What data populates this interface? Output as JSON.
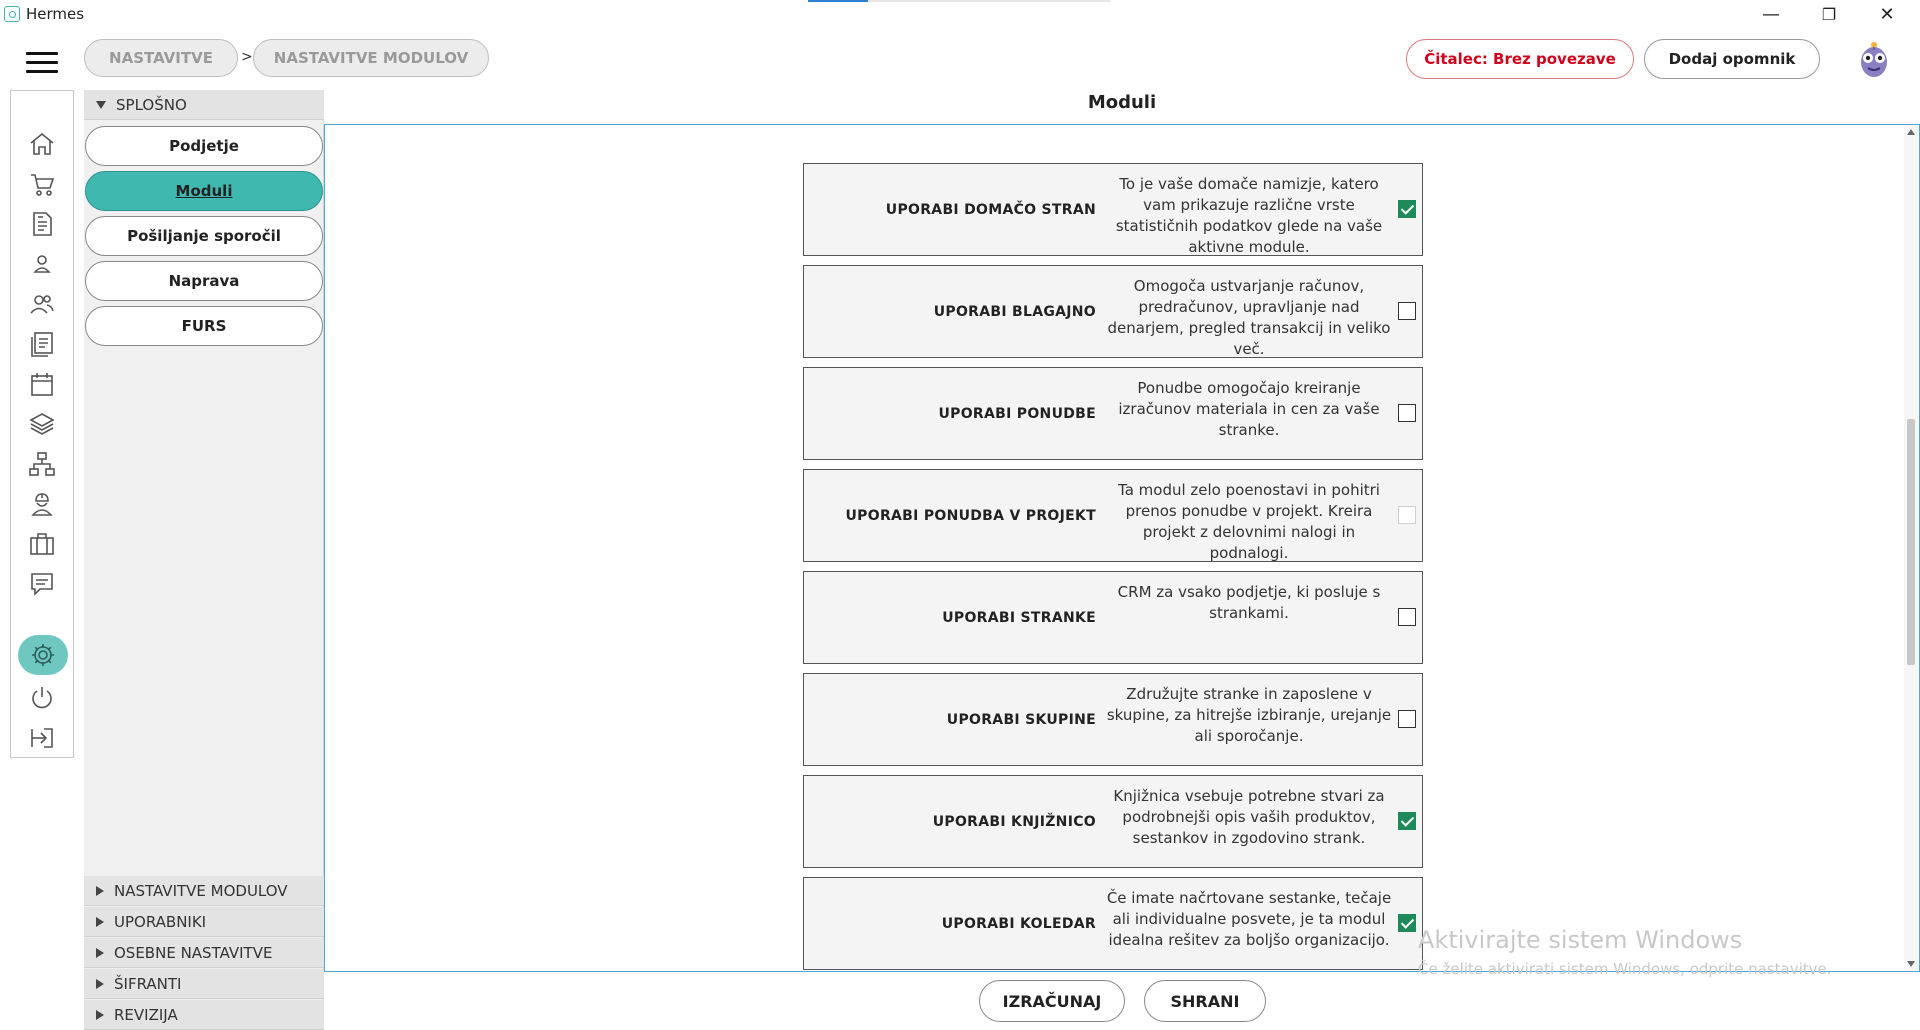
{
  "window": {
    "title": "Hermes",
    "minimize": "—",
    "restore": "❐",
    "close": "✕"
  },
  "breadcrumb": {
    "items": [
      "NASTAVITVE",
      "NASTAVITVE MODULOV"
    ],
    "separator": ">"
  },
  "header": {
    "reader_status": "Čitalec: Brez povezave",
    "add_reminder": "Dodaj opomnik"
  },
  "settings_nav": {
    "general_section": "SPLOŠNO",
    "general_items": [
      {
        "label": "Podjetje",
        "active": false
      },
      {
        "label": "Moduli",
        "active": true
      },
      {
        "label": "Pošiljanje sporočil",
        "active": false
      },
      {
        "label": "Naprava",
        "active": false
      },
      {
        "label": "FURS",
        "active": false
      }
    ],
    "collapsed_sections": [
      "NASTAVITVE MODULOV",
      "UPORABNIKI",
      "OSEBNE NASTAVITVE",
      "ŠIFRANTI",
      "REVIZIJA"
    ]
  },
  "main": {
    "title": "Moduli",
    "modules": [
      {
        "label": "UPORABI DOMAČO STRAN",
        "description": "To je vaše domače namizje, katero vam prikazuje različne vrste statističnih podatkov glede na vaše aktivne module.",
        "checked": true,
        "disabled": false
      },
      {
        "label": "UPORABI BLAGAJNO",
        "description": "Omogoča ustvarjanje računov, predračunov, upravljanje nad denarjem, pregled transakcij in veliko več.",
        "checked": false,
        "disabled": false
      },
      {
        "label": "UPORABI PONUDBE",
        "description": "Ponudbe omogočajo kreiranje izračunov materiala in cen za vaše stranke.",
        "checked": false,
        "disabled": false
      },
      {
        "label": "UPORABI PONUDBA V PROJEKT",
        "description": "Ta modul zelo poenostavi in pohitri prenos ponudbe v projekt. Kreira projekt z delovnimi nalogi in podnalogi.",
        "checked": false,
        "disabled": true
      },
      {
        "label": "UPORABI STRANKE",
        "description": "CRM za vsako podjetje, ki posluje s strankami.",
        "checked": false,
        "disabled": false
      },
      {
        "label": "UPORABI SKUPINE",
        "description": "Združujte stranke in zaposlene v skupine, za hitrejše izbiranje, urejanje ali sporočanje.",
        "checked": false,
        "disabled": false
      },
      {
        "label": "UPORABI KNJIŽNICO",
        "description": "Knjižnica vsebuje potrebne stvari za podrobnejši opis vaših produktov, sestankov in zgodovino strank.",
        "checked": true,
        "disabled": false
      },
      {
        "label": "UPORABI KOLEDAR",
        "description": "Če imate načrtovane sestanke, tečaje ali individualne posvete, je ta modul idealna rešitev za boljšo organizacijo.",
        "checked": true,
        "disabled": false
      }
    ]
  },
  "actions": {
    "calculate": "IZRAČUNAJ",
    "save": "SHRANI"
  },
  "watermark": {
    "line1": "Aktivirajte sistem Windows",
    "line2": "Če želite aktivirati sistem Windows, odprite nastavitve."
  },
  "icons": [
    "home-icon",
    "cart-icon",
    "document-icon",
    "user-icon",
    "users-icon",
    "notes-icon",
    "calendar-icon",
    "layers-icon",
    "hierarchy-icon",
    "worker-icon",
    "briefcase-icon",
    "chat-icon",
    "gear-icon",
    "power-icon",
    "logout-icon"
  ],
  "colors": {
    "accent": "#3fb8b0",
    "checked": "#1e8a5a",
    "reader_text": "#d0021b",
    "content_border": "#4aa8d8"
  }
}
